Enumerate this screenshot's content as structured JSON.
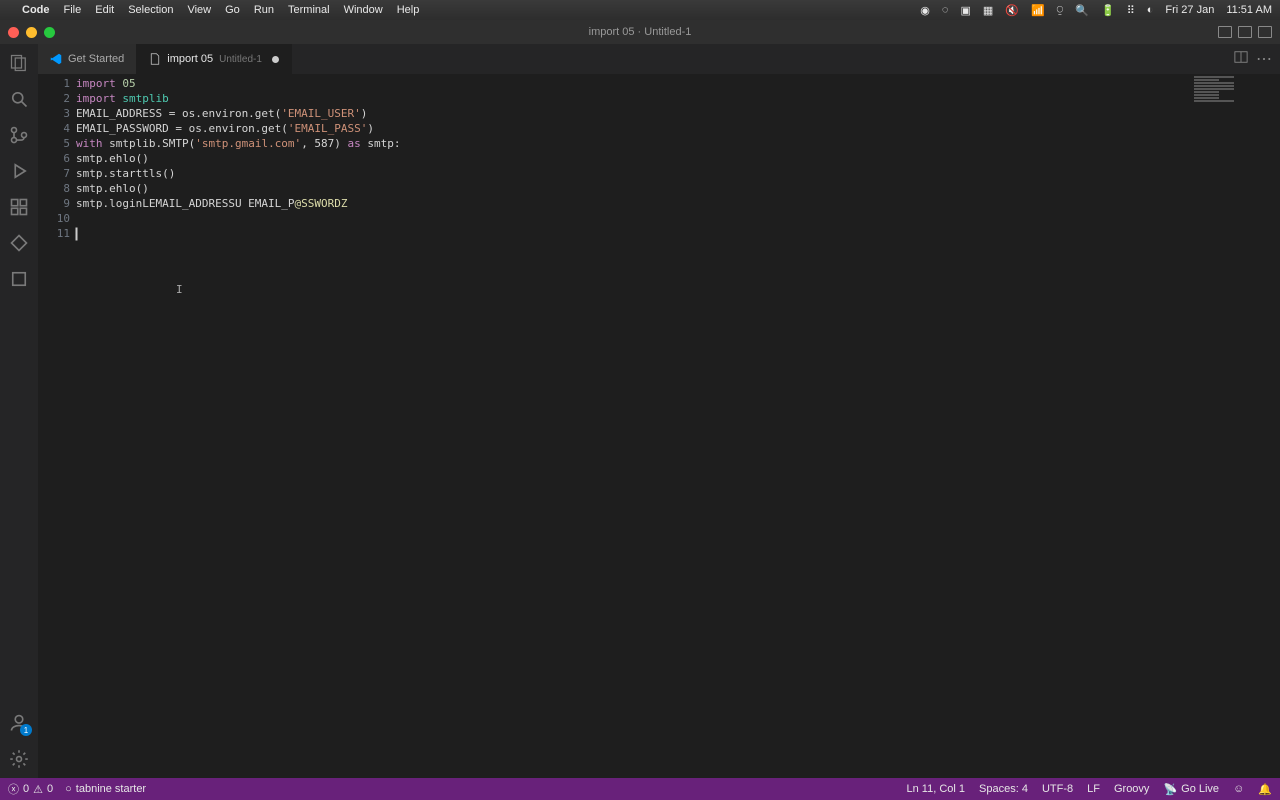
{
  "menubar": {
    "app": "Code",
    "items": [
      "File",
      "Edit",
      "Selection",
      "View",
      "Go",
      "Run",
      "Terminal",
      "Window",
      "Help"
    ],
    "date": "Fri 27 Jan",
    "time": "11:51 AM"
  },
  "window": {
    "title": "import 05 · Untitled-1"
  },
  "tabs": [
    {
      "label": "Get Started",
      "sub": "",
      "dirty": false
    },
    {
      "label": "import 05",
      "sub": "Untitled-1",
      "dirty": true
    }
  ],
  "code_lines": [
    {
      "n": "1",
      "seg": [
        {
          "t": "import",
          "c": "kw"
        },
        {
          "t": " ",
          "c": ""
        },
        {
          "t": "05",
          "c": "num"
        }
      ]
    },
    {
      "n": "2",
      "seg": [
        {
          "t": "import",
          "c": "kw"
        },
        {
          "t": " ",
          "c": ""
        },
        {
          "t": "smtplib",
          "c": "mod"
        }
      ]
    },
    {
      "n": "3",
      "seg": [
        {
          "t": "EMAIL_ADDRESS = os.environ.get(",
          "c": ""
        },
        {
          "t": "'EMAIL_USER'",
          "c": "str"
        },
        {
          "t": ")",
          "c": ""
        }
      ]
    },
    {
      "n": "4",
      "seg": [
        {
          "t": "EMAIL_PASSWORD = os.environ.get(",
          "c": ""
        },
        {
          "t": "'EMAIL_PASS'",
          "c": "str"
        },
        {
          "t": ")",
          "c": ""
        }
      ]
    },
    {
      "n": "5",
      "seg": [
        {
          "t": "with",
          "c": "kw"
        },
        {
          "t": " smtplib.SMTP(",
          "c": ""
        },
        {
          "t": "'smtp.gmail.com'",
          "c": "str"
        },
        {
          "t": ", 587) ",
          "c": ""
        },
        {
          "t": "as",
          "c": "kw"
        },
        {
          "t": " smtp:",
          "c": ""
        }
      ]
    },
    {
      "n": "6",
      "seg": [
        {
          "t": "smtp.ehlo()",
          "c": ""
        }
      ]
    },
    {
      "n": "7",
      "seg": [
        {
          "t": "smtp.starttls()",
          "c": ""
        }
      ]
    },
    {
      "n": "8",
      "seg": [
        {
          "t": "smtp.ehlo()",
          "c": ""
        }
      ]
    },
    {
      "n": "9",
      "seg": [
        {
          "t": "smtp.loginLEMAIL_ADDRESSU EMAIL_P",
          "c": ""
        },
        {
          "t": "@SSWORDZ",
          "c": "decor"
        }
      ]
    },
    {
      "n": "10",
      "seg": []
    },
    {
      "n": "11",
      "seg": []
    }
  ],
  "statusbar": {
    "errors": "0",
    "warnings": "0",
    "tabnine": "tabnine starter",
    "cursor": "Ln 11, Col 1",
    "spaces": "Spaces: 4",
    "encoding": "UTF-8",
    "eol": "LF",
    "lang": "Groovy",
    "golive": "Go Live"
  }
}
